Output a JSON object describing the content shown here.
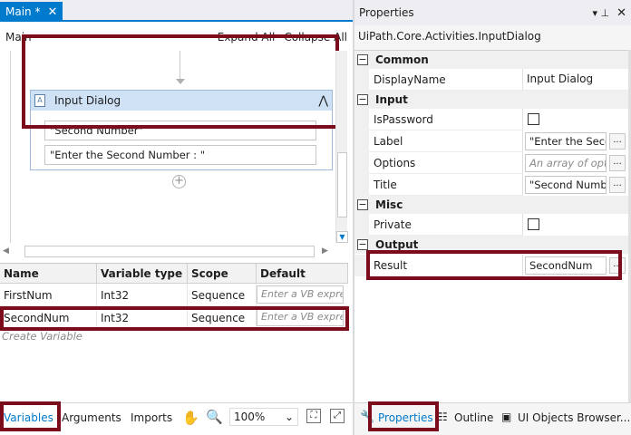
{
  "designer": {
    "tab_label": "Main *",
    "tab_close": "✕",
    "breadcrumb": "Main",
    "expand_all": "Expand All",
    "collapse_all": "Collapse All"
  },
  "activity": {
    "title": "Input Dialog",
    "title_field": "\"Second Number\"",
    "label_field": "\"Enter the Second Number  :  \"",
    "collapse_icon": "⋀",
    "icon_glyph": "A",
    "add_icon": "+"
  },
  "variables": {
    "columns": [
      "Name",
      "Variable type",
      "Scope",
      "Default"
    ],
    "rows": [
      {
        "name": "FirstNum",
        "type": "Int32",
        "scope": "Sequence",
        "default": "Enter a VB expre"
      },
      {
        "name": "SecondNum",
        "type": "Int32",
        "scope": "Sequence",
        "default": "Enter a VB expre"
      }
    ],
    "create_label": "Create Variable"
  },
  "bottom_tabs": {
    "variables": "Variables",
    "arguments": "Arguments",
    "imports": "Imports",
    "zoom_value": "100%",
    "zoom_chevron": "⌄",
    "pan_icon": "✋",
    "zoom_icon": "🔍",
    "fit_icon": "⛶",
    "reset_icon": "⤢"
  },
  "properties": {
    "panel_title": "Properties",
    "pin_icon": "📌",
    "close_icon": "✕",
    "subtitle": "UiPath.Core.Activities.InputDialog",
    "categories": [
      {
        "label": "Common",
        "toggle": "−"
      },
      {
        "label": "Input",
        "toggle": "−"
      },
      {
        "label": "Misc",
        "toggle": "−"
      },
      {
        "label": "Output",
        "toggle": "−"
      }
    ],
    "display_name": {
      "name": "DisplayName",
      "value": "Input Dialog"
    },
    "is_password": {
      "name": "IsPassword"
    },
    "label": {
      "name": "Label",
      "value": "\"Enter the Seco"
    },
    "options": {
      "name": "Options",
      "placeholder": "An array of opti"
    },
    "title": {
      "name": "Title",
      "value": "\"Second Numbe"
    },
    "private": {
      "name": "Private"
    },
    "result": {
      "name": "Result",
      "value": "SecondNum"
    },
    "ellipsis": "..."
  },
  "right_tabs": {
    "properties": "Properties",
    "outline": "Outline",
    "ui_objects": "UI Objects Browser..."
  },
  "colors": {
    "accent": "#007acc",
    "highlight": "#7a0c1c",
    "activity_header": "#cfe1f5"
  }
}
